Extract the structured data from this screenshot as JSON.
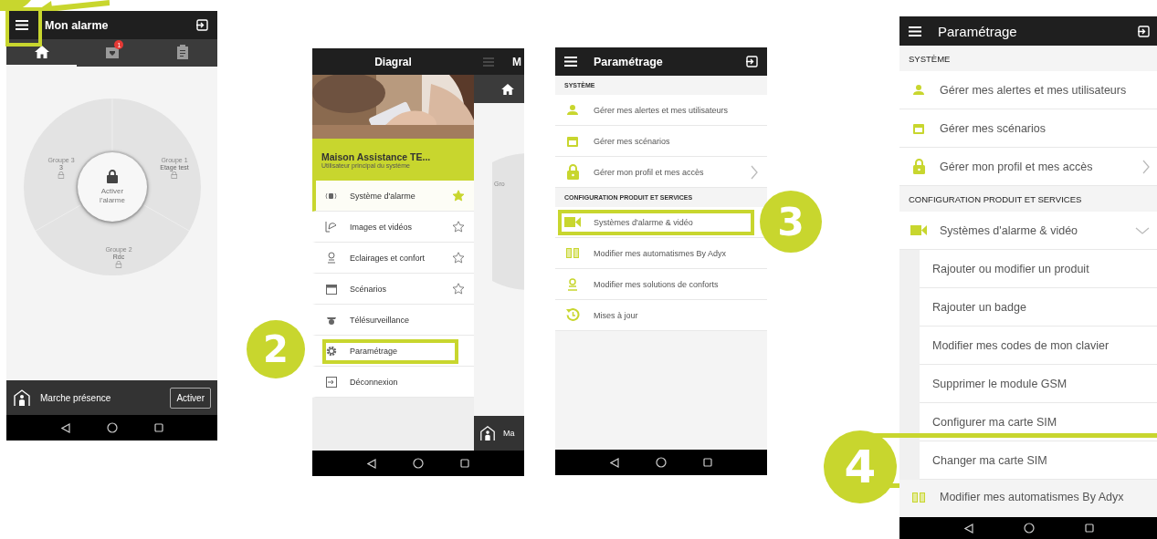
{
  "home_screen": {
    "title": "Mon alarme",
    "tabs": [
      {
        "selected": true
      },
      {
        "selected": false,
        "badge": "1"
      },
      {
        "selected": false
      }
    ],
    "groups": [
      {
        "label": "Groupe 3",
        "name": "3"
      },
      {
        "label": "Groupe 1",
        "name": "Etage test"
      },
      {
        "label": "Groupe 2",
        "name": "Rdc"
      }
    ],
    "center_label": "Activer l'alarme",
    "mode": {
      "label": "Marche présence",
      "button": "Activer"
    }
  },
  "menu_screen": {
    "title": "Diagral",
    "account": {
      "name": "Maison Assistance TE...",
      "role": "Utilisateur principal du système"
    },
    "items": [
      {
        "label": "Système d'alarme",
        "selected": true,
        "starred": true,
        "highlighted": false
      },
      {
        "label": "Images et vidéos",
        "selected": false,
        "starred": false,
        "highlighted": false
      },
      {
        "label": "Eclairages et confort",
        "selected": false,
        "starred": false,
        "highlighted": false
      },
      {
        "label": "Scénarios",
        "selected": false,
        "starred": false,
        "highlighted": false
      },
      {
        "label": "Télésurveillance",
        "selected": false,
        "highlighted": false
      },
      {
        "label": "Paramétrage",
        "selected": false,
        "highlighted": true
      },
      {
        "label": "Déconnexion",
        "selected": false,
        "highlighted": false
      }
    ],
    "background_screen": {
      "title": "M",
      "group_label": "Gro",
      "mode_label": "Ma"
    }
  },
  "settings_screens": [
    {
      "title": "Paramétrage",
      "sections": [
        {
          "title": "SYSTÈME",
          "items": [
            {
              "label": "Gérer mes alertes et mes utilisateurs",
              "highlighted": false
            },
            {
              "label": "Gérer mes scénarios",
              "highlighted": false
            },
            {
              "label": "Gérer mon profil et mes accès",
              "highlighted": false,
              "expanded": false
            }
          ]
        },
        {
          "title": "CONFIGURATION PRODUIT ET SERVICES",
          "items": [
            {
              "label": "Systèmes d'alarme & vidéo",
              "highlighted": true
            },
            {
              "label": "Modifier mes automatismes By Adyx",
              "highlighted": false
            },
            {
              "label": "Modifier mes solutions de conforts",
              "highlighted": false
            },
            {
              "label": "Mises à jour",
              "highlighted": false
            }
          ]
        }
      ]
    },
    {
      "title": "Paramétrage",
      "sections": [
        {
          "title": "SYSTÈME",
          "items": [
            {
              "label": "Gérer mes alertes et mes utilisateurs",
              "highlighted": false
            },
            {
              "label": "Gérer mes scénarios",
              "highlighted": false
            },
            {
              "label": "Gérer mon profil et mes accès",
              "highlighted": false,
              "expanded": false
            }
          ]
        },
        {
          "title": "CONFIGURATION PRODUIT ET SERVICES",
          "items": [
            {
              "label": "Systèmes d'alarme & vidéo",
              "highlighted": false,
              "expanded": true,
              "children": [
                {
                  "label": "Rajouter ou modifier un produit",
                  "highlighted": false
                },
                {
                  "label": "Rajouter un badge",
                  "highlighted": false
                },
                {
                  "label": "Modifier mes codes de mon clavier",
                  "highlighted": false
                },
                {
                  "label": "Supprimer le module GSM",
                  "highlighted": false
                },
                {
                  "label": "Configurer ma carte SIM",
                  "highlighted": false
                },
                {
                  "label": "Changer ma carte SIM",
                  "highlighted": true
                }
              ]
            },
            {
              "label": "Modifier mes automatismes By Adyx",
              "highlighted": false
            }
          ]
        }
      ]
    }
  ],
  "steps": [
    {
      "number": "2"
    },
    {
      "number": "3"
    },
    {
      "number": "4"
    }
  ]
}
